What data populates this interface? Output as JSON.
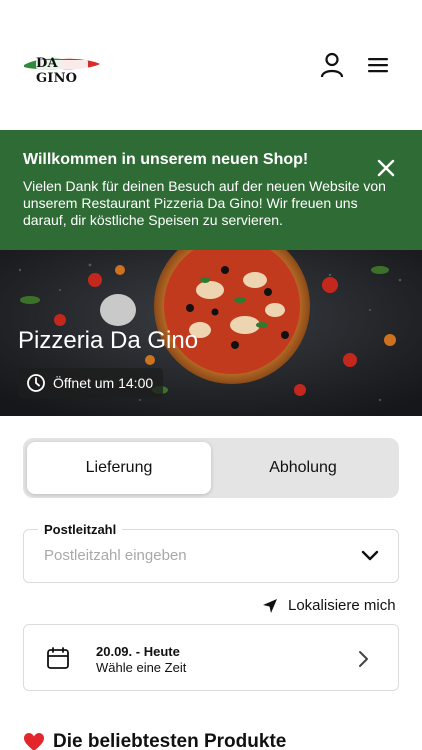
{
  "brand": {
    "logo_text": "DA GINO",
    "colors": {
      "green": "#2f8a3a",
      "red": "#d82b2b",
      "white": "#ffffff"
    }
  },
  "header": {
    "user_icon": "user-icon",
    "menu_icon": "hamburger-menu-icon"
  },
  "banner": {
    "title": "Willkommen in unserem neuen Shop!",
    "text": "Vielen Dank für deinen Besuch auf der neuen Website von unserem Restaurant Pizzeria Da Gino! Wir freuen uns darauf, dir köstliche Speisen zu servieren.",
    "close_icon": "close-icon",
    "background": "#2f6b35"
  },
  "hero": {
    "title": "Pizzeria Da Gino",
    "hours": "Öffnet um 14:00",
    "clock_icon": "clock-icon"
  },
  "order_mode": {
    "options": [
      "Lieferung",
      "Abholung"
    ],
    "selected": "Lieferung"
  },
  "postcode": {
    "label": "Postleitzahl",
    "placeholder": "Postleitzahl eingeben",
    "value": ""
  },
  "locate": {
    "label": "Lokalisiere mich",
    "icon": "location-arrow-icon"
  },
  "date_picker": {
    "date": "20.09. - Heute",
    "hint": "Wähle eine Zeit",
    "icon": "calendar-icon"
  },
  "popular": {
    "heading": "Die beliebtesten Produkte",
    "icon": "heart-icon"
  }
}
